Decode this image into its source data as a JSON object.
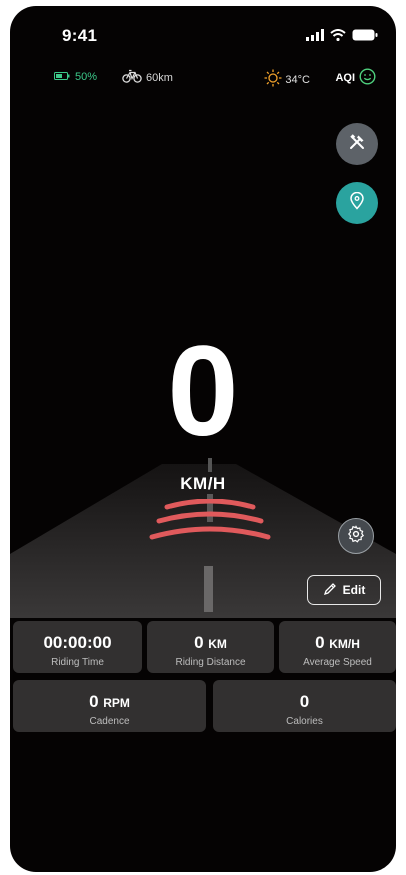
{
  "status_bar": {
    "time": "9:41"
  },
  "info_bar": {
    "battery_percent": "50%",
    "range": "60km",
    "temperature": "34°C",
    "aqi_label": "AQI"
  },
  "speed": {
    "value": "0",
    "unit": "KM/H"
  },
  "edit_button": {
    "label": "Edit"
  },
  "stats": [
    {
      "value": "00:00:00",
      "unit": "",
      "label": "Riding Time"
    },
    {
      "value": "0",
      "unit": "KM",
      "label": "Riding Distance"
    },
    {
      "value": "0",
      "unit": "KM/H",
      "label": "Average Speed"
    },
    {
      "value": "0",
      "unit": "RPM",
      "label": "Cadence"
    },
    {
      "value": "0",
      "unit": "",
      "label": "Calories"
    }
  ],
  "colors": {
    "background": "#050303",
    "battery_green": "#3cc98a",
    "weather_orange": "#f1a12b",
    "aqi_green": "#4fd07e",
    "location_teal": "#2aa39f",
    "radar_red": "#e05a5c",
    "card_bg": "#323030"
  },
  "icons": [
    "signal-icon",
    "wifi-icon",
    "battery-icon",
    "bike-icon",
    "sun-icon",
    "smiley-icon",
    "tools-icon",
    "location-icon",
    "gear-icon",
    "pen-icon"
  ]
}
